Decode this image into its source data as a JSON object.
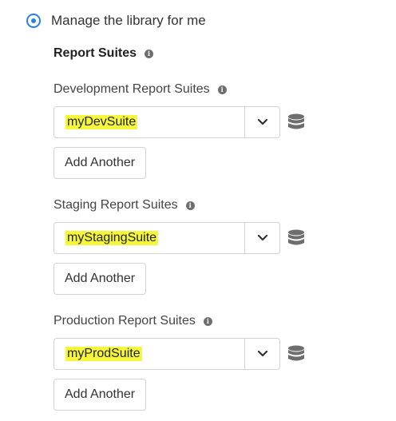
{
  "option": {
    "label": "Manage the library for me",
    "selected": true
  },
  "report_suites": {
    "title": "Report Suites"
  },
  "groups": [
    {
      "label": "Development Report Suites",
      "value": "myDevSuite",
      "add_label": "Add Another"
    },
    {
      "label": "Staging Report Suites",
      "value": "myStagingSuite",
      "add_label": "Add Another"
    },
    {
      "label": "Production Report Suites",
      "value": "myProdSuite",
      "add_label": "Add Another"
    }
  ],
  "colors": {
    "accent": "#2680eb",
    "highlight": "#f6f63a",
    "icon": "#6e6e6e"
  }
}
